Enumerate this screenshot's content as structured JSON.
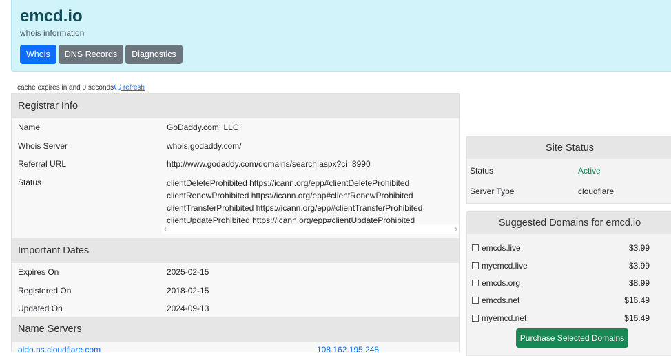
{
  "header": {
    "title": "emcd.io",
    "subtitle": "whois information",
    "tabs": [
      {
        "label": "Whois",
        "active": true
      },
      {
        "label": "DNS Records",
        "active": false
      },
      {
        "label": "Diagnostics",
        "active": false
      }
    ]
  },
  "cache": {
    "text": "cache expires in and 0 seconds",
    "refresh_label": " refresh"
  },
  "registrar": {
    "heading": "Registrar Info",
    "name_label": "Name",
    "name_value": "GoDaddy.com, LLC",
    "whois_label": "Whois Server",
    "whois_value": "whois.godaddy.com/",
    "referral_label": "Referral URL",
    "referral_value": "http://www.godaddy.com/domains/search.aspx?ci=8990",
    "status_label": "Status",
    "status_lines": [
      "clientDeleteProhibited https://icann.org/epp#clientDeleteProhibited",
      "clientRenewProhibited https://icann.org/epp#clientRenewProhibited",
      "clientTransferProhibited https://icann.org/epp#clientTransferProhibited",
      "clientUpdateProhibited https://icann.org/epp#clientUpdateProhibited"
    ]
  },
  "dates": {
    "heading": "Important Dates",
    "expires_label": "Expires On",
    "expires_value": "2025-02-15",
    "registered_label": "Registered On",
    "registered_value": "2018-02-15",
    "updated_label": "Updated On",
    "updated_value": "2024-09-13"
  },
  "nameservers": {
    "heading": "Name Servers",
    "first_server": "aldo.ns.cloudflare.com",
    "first_ip": "108.162.195.248"
  },
  "site_status": {
    "heading": "Site Status",
    "status_label": "Status",
    "status_value": "Active",
    "server_label": "Server Type",
    "server_value": "cloudflare"
  },
  "suggested": {
    "heading": "Suggested Domains for emcd.io",
    "domains": [
      {
        "name": "emcds.live",
        "price": "$3.99"
      },
      {
        "name": "myemcd.live",
        "price": "$3.99"
      },
      {
        "name": "emcds.org",
        "price": "$8.99"
      },
      {
        "name": "emcds.net",
        "price": "$16.49"
      },
      {
        "name": "myemcd.net",
        "price": "$16.49"
      }
    ],
    "button_label": "Purchase Selected Domains"
  },
  "colors": {
    "header_bg": "#d1f3fa",
    "tab_active": "#0d6efd",
    "tab_inactive": "#6c757d",
    "active_status": "#198754",
    "purchase_button": "#198754"
  }
}
